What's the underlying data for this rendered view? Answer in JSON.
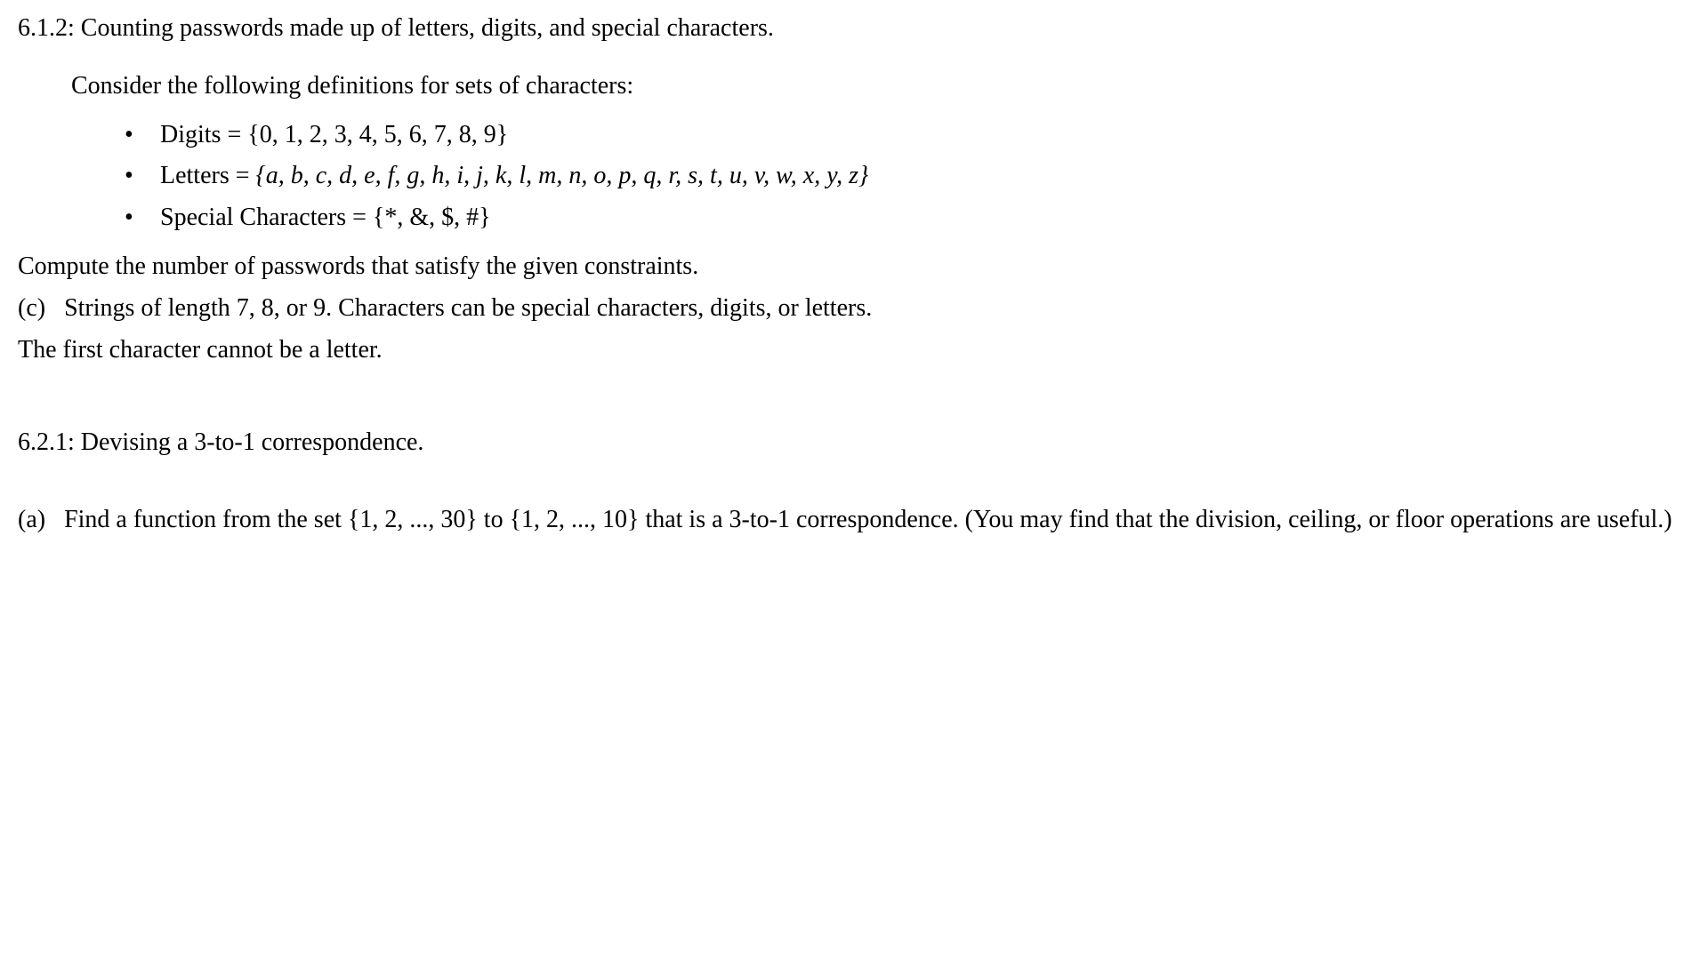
{
  "problem1": {
    "title": "6.1.2: Counting passwords made up of letters, digits, and special characters.",
    "intro": "Consider the following definitions for sets of characters:",
    "bullets": {
      "digits_label": "Digits = ",
      "digits_set": "{0, 1, 2, 3, 4, 5, 6, 7, 8, 9}",
      "letters_label": "Letters = ",
      "letters_set": "{a, b, c, d, e, f, g, h, i, j, k, l, m, n, o, p, q, r, s, t, u, v, w, x, y, z}",
      "special_label": "Special Characters = ",
      "special_set": "{*, &, $, #}"
    },
    "compute": "Compute the number of passwords that satisfy the given constraints.",
    "part_c_line1": "(c)   Strings of length 7, 8, or 9. Characters can be special characters, digits, or letters.",
    "part_c_line2": "The first character cannot be a letter."
  },
  "problem2": {
    "title": "6.2.1: Devising a 3-to-1 correspondence.",
    "part_a": "(a)   Find a function from the set {1, 2, ..., 30} to {1, 2, ..., 10} that is a 3-to-1 correspondence. (You may find that the division, ceiling, or floor operations are useful.)"
  }
}
